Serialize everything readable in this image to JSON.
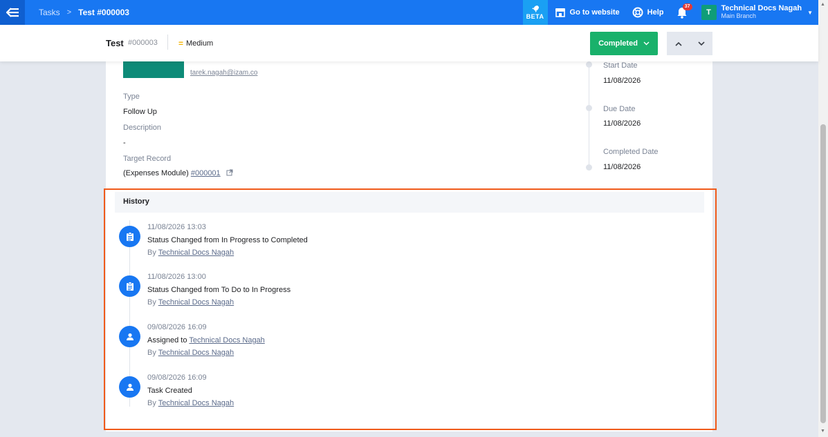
{
  "topbar": {
    "breadcrumb_parent": "Tasks",
    "breadcrumb_separator": ">",
    "breadcrumb_current": "Test #000003",
    "beta_label": "BETA",
    "website_label": "Go to website",
    "help_label": "Help",
    "notification_count": "37",
    "account_initial": "T",
    "account_name": "Technical Docs Nagah",
    "account_branch": "Main Branch",
    "accent_color": "#1877f2"
  },
  "subheader": {
    "title": "Test",
    "number": "#000003",
    "priority_icon": "=",
    "priority": "Medium",
    "status": "Completed",
    "status_color": "#19b16b"
  },
  "details": {
    "assignee_email": "tarek.nagah@izam.co",
    "type_label": "Type",
    "type_value": "Follow Up",
    "description_label": "Description",
    "description_value": "-",
    "target_label": "Target Record",
    "target_prefix": "(Expenses Module)",
    "target_link": "#000001"
  },
  "dates": {
    "start_label": "Start Date",
    "start_value": "11/08/2026",
    "due_label": "Due Date",
    "due_value": "11/08/2026",
    "completed_label": "Completed Date",
    "completed_value": "11/08/2026"
  },
  "history": {
    "title": "History",
    "by_prefix": "By",
    "entries": [
      {
        "icon": "clipboard-icon",
        "date": "11/08/2026 13:03",
        "text": "Status Changed from In Progress to Completed",
        "text_link": "",
        "by": "Technical Docs Nagah"
      },
      {
        "icon": "clipboard-icon",
        "date": "11/08/2026 13:00",
        "text": "Status Changed from To Do to In Progress",
        "text_link": "",
        "by": "Technical Docs Nagah"
      },
      {
        "icon": "user-icon",
        "date": "09/08/2026 16:09",
        "text": "Assigned to",
        "text_link": "Technical Docs Nagah",
        "by": "Technical Docs Nagah"
      },
      {
        "icon": "user-icon",
        "date": "09/08/2026 16:09",
        "text": "Task Created",
        "text_link": "",
        "by": "Technical Docs Nagah"
      }
    ]
  }
}
